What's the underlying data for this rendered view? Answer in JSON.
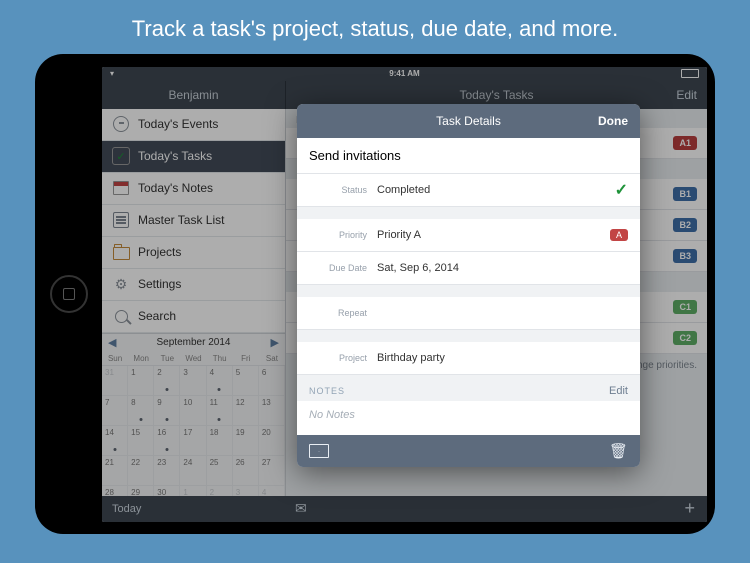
{
  "promo": "Track a task's project, status, due date, and more.",
  "statusbar": {
    "time": "9:41 AM"
  },
  "topbar": {
    "user": "Benjamin",
    "title": "Today's Tasks",
    "edit": "Edit"
  },
  "sidebar": {
    "items": [
      {
        "label": "Today's Events"
      },
      {
        "label": "Today's Tasks"
      },
      {
        "label": "Today's Notes"
      },
      {
        "label": "Master Task List"
      },
      {
        "label": "Projects"
      },
      {
        "label": "Settings"
      },
      {
        "label": "Search"
      }
    ]
  },
  "calendar": {
    "month": "September 2014",
    "dow": [
      "Sun",
      "Mon",
      "Tue",
      "Wed",
      "Thu",
      "Fri",
      "Sat"
    ],
    "cells": [
      {
        "d": "31",
        "dim": true
      },
      {
        "d": "1"
      },
      {
        "d": "2",
        "dot": true
      },
      {
        "d": "3"
      },
      {
        "d": "4",
        "dot": true
      },
      {
        "d": "5"
      },
      {
        "d": "6"
      },
      {
        "d": "7"
      },
      {
        "d": "8",
        "dot": true
      },
      {
        "d": "9",
        "dot": true
      },
      {
        "d": "10"
      },
      {
        "d": "11",
        "dot": true
      },
      {
        "d": "12"
      },
      {
        "d": "13"
      },
      {
        "d": "14",
        "dot": true
      },
      {
        "d": "15"
      },
      {
        "d": "16",
        "dot": true
      },
      {
        "d": "17"
      },
      {
        "d": "18"
      },
      {
        "d": "19"
      },
      {
        "d": "20"
      },
      {
        "d": "21"
      },
      {
        "d": "22"
      },
      {
        "d": "23"
      },
      {
        "d": "24"
      },
      {
        "d": "25"
      },
      {
        "d": "26"
      },
      {
        "d": "27"
      },
      {
        "d": "28"
      },
      {
        "d": "29"
      },
      {
        "d": "30"
      },
      {
        "d": "1",
        "dim": true
      },
      {
        "d": "2",
        "dim": true
      },
      {
        "d": "3",
        "dim": true
      },
      {
        "d": "4",
        "dim": true
      }
    ]
  },
  "priorityA_label": "Priority A",
  "badges": {
    "a1": "A1",
    "b1": "B1",
    "b2": "B2",
    "b3": "B3",
    "c1": "C1",
    "c2": "C2"
  },
  "hint": "…nge priorities.",
  "bottombar": {
    "today": "Today"
  },
  "modal": {
    "header": "Task Details",
    "done": "Done",
    "task_title": "Send invitations",
    "rows": {
      "status": {
        "label": "Status",
        "value": "Completed"
      },
      "priority": {
        "label": "Priority",
        "value": "Priority A",
        "badge": "A"
      },
      "due": {
        "label": "Due Date",
        "value": "Sat, Sep 6, 2014"
      },
      "repeat": {
        "label": "Repeat",
        "value": ""
      },
      "project": {
        "label": "Project",
        "value": "Birthday party"
      }
    },
    "notes_header": "NOTES",
    "notes_edit": "Edit",
    "notes_body": "No Notes"
  }
}
